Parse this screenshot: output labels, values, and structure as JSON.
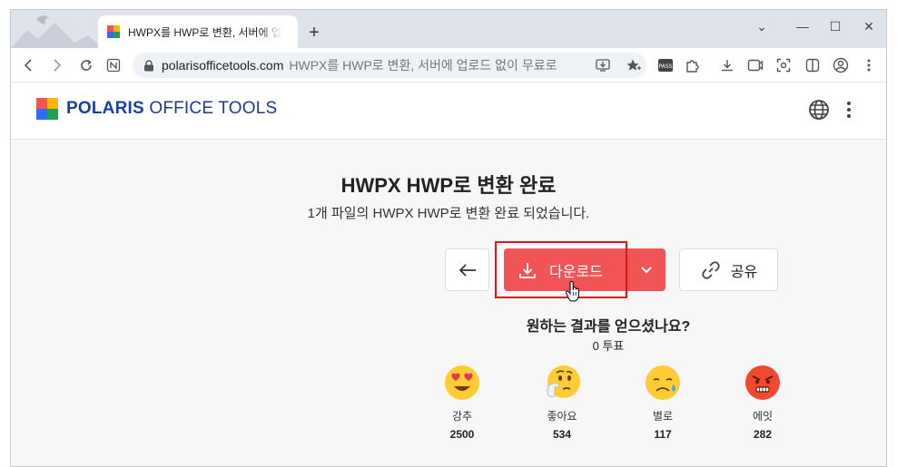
{
  "browser": {
    "tab_title": "HWPX를 HWP로 변환, 서버에 업로드 없이 무료로",
    "new_tab": "+",
    "url": "polarisofficetools.com",
    "url_title": "HWPX를 HWP로 변환, 서버에 업로드 없이 무료로",
    "controls": {
      "dropdown": "⌄",
      "minimize": "—",
      "maximize": "☐",
      "close": "✕"
    }
  },
  "site": {
    "logo_bold": "POLARIS",
    "logo_light": " OFFICE TOOLS"
  },
  "main": {
    "title": "HWPX HWP로 변환 완료",
    "subtitle": "1개 파일의 HWPX HWP로 변환 완료 되었습니다.",
    "download_label": "다운로드",
    "share_label": "공유",
    "question": "원하는 결과를 얻으셨나요?",
    "votes": "0 투표"
  },
  "ratings": [
    {
      "label": "강추",
      "count": "2500",
      "icon": "heart-eyes-emoji"
    },
    {
      "label": "좋아요",
      "count": "534",
      "icon": "thinking-emoji"
    },
    {
      "label": "별로",
      "count": "117",
      "icon": "sad-emoji"
    },
    {
      "label": "에잇",
      "count": "282",
      "icon": "angry-emoji"
    }
  ],
  "colors": {
    "accent": "#f05454",
    "brand_blue": "#1b3fa8",
    "highlight": "#e01515"
  }
}
